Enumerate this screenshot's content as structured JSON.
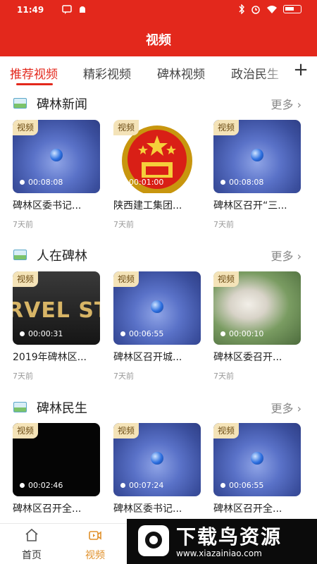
{
  "status_bar": {
    "time": "11:49",
    "left_icons": [
      "message-icon",
      "android-debug-icon"
    ],
    "right_icons": [
      "bluetooth-icon",
      "alarm-icon",
      "wifi-icon",
      "battery-icon"
    ]
  },
  "header": {
    "title": "视频"
  },
  "tabs": [
    {
      "label": "推荐视频",
      "active": true
    },
    {
      "label": "精彩视频",
      "active": false
    },
    {
      "label": "碑林视频",
      "active": false
    },
    {
      "label": "政治民生",
      "active": false
    }
  ],
  "tab_add_label": "+",
  "sections": [
    {
      "title": "碑林新闻",
      "more": "更多",
      "cards": [
        {
          "badge": "视频",
          "duration": "00:08:08",
          "title": "碑林区委书记...",
          "time": "7天前",
          "thumb": "blue"
        },
        {
          "badge": "视频",
          "duration": "00:01:00",
          "title": "陕西建工集团...",
          "time": "7天前",
          "thumb": "emblem"
        },
        {
          "badge": "视频",
          "duration": "00:08:08",
          "title": "碑林区召开“三...",
          "time": "7天前",
          "thumb": "blue"
        }
      ]
    },
    {
      "title": "人在碑林",
      "more": "更多",
      "cards": [
        {
          "badge": "视频",
          "duration": "00:00:31",
          "title": "2019年碑林区...",
          "time": "7天前",
          "thumb": "marvel",
          "overlay_text": "RVEL STUD"
        },
        {
          "badge": "视频",
          "duration": "00:06:55",
          "title": "碑林区召开城...",
          "time": "7天前",
          "thumb": "blue"
        },
        {
          "badge": "视频",
          "duration": "00:00:10",
          "title": "碑林区委召开...",
          "time": "7天前",
          "thumb": "grass"
        }
      ]
    },
    {
      "title": "碑林民生",
      "more": "更多",
      "cards": [
        {
          "badge": "视频",
          "duration": "00:02:46",
          "title": "碑林区召开全...",
          "time": "",
          "thumb": "black"
        },
        {
          "badge": "视频",
          "duration": "00:07:24",
          "title": "碑林区委书记...",
          "time": "",
          "thumb": "blue"
        },
        {
          "badge": "视频",
          "duration": "00:06:55",
          "title": "碑林区召开全...",
          "time": "",
          "thumb": "blue"
        }
      ]
    }
  ],
  "bottom_nav": [
    {
      "label": "首页",
      "icon": "home-icon",
      "active": false
    },
    {
      "label": "视频",
      "icon": "video-icon",
      "active": true
    }
  ],
  "watermark": {
    "main": "下载鸟资源",
    "url": "www.xiazainiao.com"
  },
  "colors": {
    "brand_red": "#e3281c",
    "badge_bg": "#f4e3b8",
    "nav_active": "#e0902a"
  }
}
